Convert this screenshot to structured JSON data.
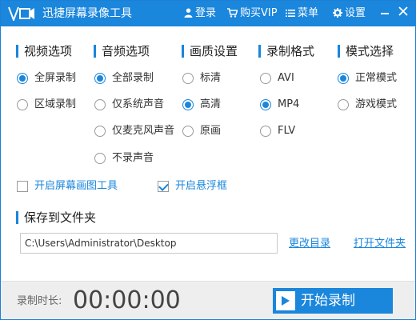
{
  "app": {
    "title": "迅捷屏幕录像工具"
  },
  "titlebar": {
    "login": "登录",
    "vip": "购买VIP",
    "menu": "菜单",
    "settings": "设置"
  },
  "sections": {
    "video": {
      "title": "视频选项",
      "options": [
        {
          "label": "全屏录制",
          "selected": true
        },
        {
          "label": "区域录制",
          "selected": false
        }
      ]
    },
    "audio": {
      "title": "音频选项",
      "options": [
        {
          "label": "全部录制",
          "selected": true
        },
        {
          "label": "仅系统声音",
          "selected": false
        },
        {
          "label": "仅麦克风声音",
          "selected": false
        },
        {
          "label": "不录声音",
          "selected": false
        }
      ]
    },
    "quality": {
      "title": "画质设置",
      "options": [
        {
          "label": "标清",
          "selected": false
        },
        {
          "label": "高清",
          "selected": true
        },
        {
          "label": "原画",
          "selected": false
        }
      ]
    },
    "format": {
      "title": "录制格式",
      "options": [
        {
          "label": "AVI",
          "selected": false
        },
        {
          "label": "MP4",
          "selected": true
        },
        {
          "label": "FLV",
          "selected": false
        }
      ]
    },
    "mode": {
      "title": "模式选择",
      "options": [
        {
          "label": "正常模式",
          "selected": true
        },
        {
          "label": "游戏模式",
          "selected": false
        }
      ]
    }
  },
  "checkboxes": {
    "draw_tool": {
      "label": "开启屏幕画图工具",
      "checked": false
    },
    "float_frame": {
      "label": "开启悬浮框",
      "checked": true
    }
  },
  "save": {
    "title": "保存到文件夹",
    "path": "C:\\Users\\Administrator\\Desktop",
    "change_dir": "更改目录",
    "open_folder": "打开文件夹"
  },
  "footer": {
    "duration_label": "录制时长:",
    "timer": "00:00:00",
    "start_label": "开始录制"
  },
  "colors": {
    "accent": "#1a86dc",
    "footer_bg": "#eeeeee"
  }
}
